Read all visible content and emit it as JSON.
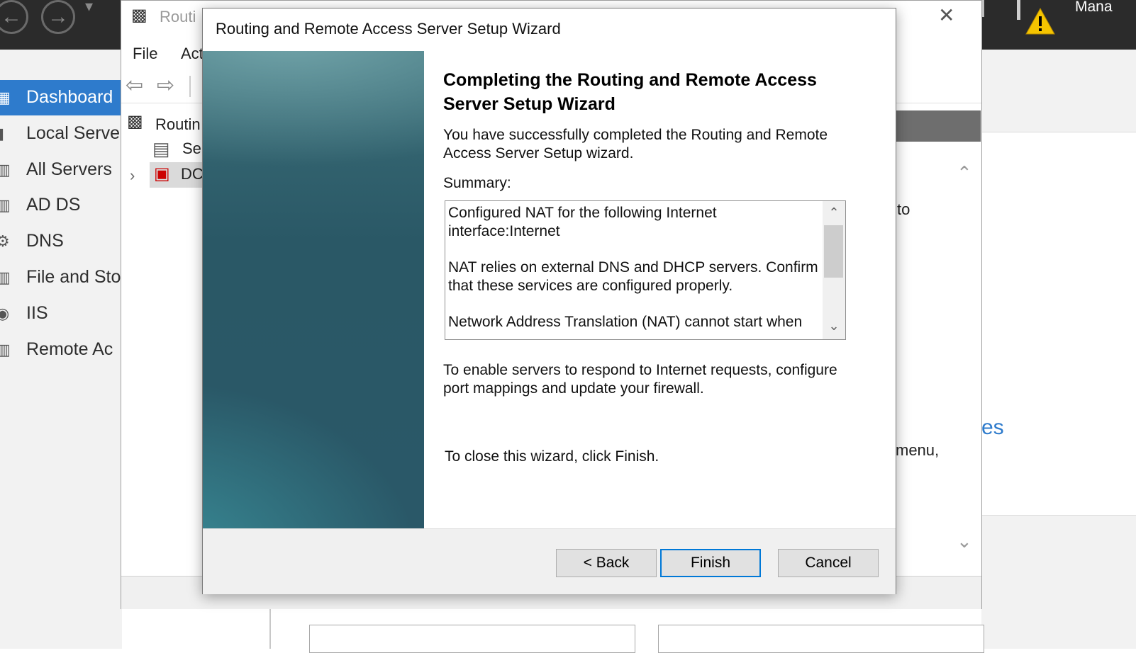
{
  "server_manager": {
    "title_fragment": "Mana",
    "sidebar": {
      "items": [
        {
          "label": "Dashboard",
          "icon": "dashboard-grid-icon",
          "active": true
        },
        {
          "label": "Local Serve",
          "icon": "server-icon"
        },
        {
          "label": "All Servers",
          "icon": "servers-icon"
        },
        {
          "label": "AD DS",
          "icon": "ad-ds-icon"
        },
        {
          "label": "DNS",
          "icon": "dns-icon"
        },
        {
          "label": "File and Sto",
          "icon": "file-storage-icon"
        },
        {
          "label": "IIS",
          "icon": "iis-icon"
        },
        {
          "label": "Remote Ac",
          "icon": "remote-access-icon"
        }
      ]
    },
    "background_fragments": {
      "to": "to",
      "menu": "menu,",
      "es": "es"
    }
  },
  "mmc": {
    "title_fragment": "Routi",
    "menu": {
      "file": "File",
      "action": "Act"
    },
    "tree": {
      "root": "Routin",
      "server_status": "Ser",
      "dc": "DC"
    },
    "close_glyph": "✕"
  },
  "wizard": {
    "title": "Routing and Remote Access Server Setup Wizard",
    "heading": "Completing the Routing and Remote Access Server Setup Wizard",
    "intro": "You have successfully completed the Routing and Remote Access Server Setup wizard.",
    "summary_label": "Summary:",
    "summary": {
      "p1": "Configured NAT for the following Internet interface:Internet",
      "p2": "NAT relies on external DNS and DHCP servers. Confirm that these services are configured properly.",
      "p3": "Network Address Translation (NAT) cannot start when"
    },
    "enable_text": "To enable servers to respond to Internet requests, configure port mappings and update your firewall.",
    "close_text": "To close this wizard, click Finish.",
    "buttons": {
      "back": "< Back",
      "finish": "Finish",
      "cancel": "Cancel"
    }
  }
}
